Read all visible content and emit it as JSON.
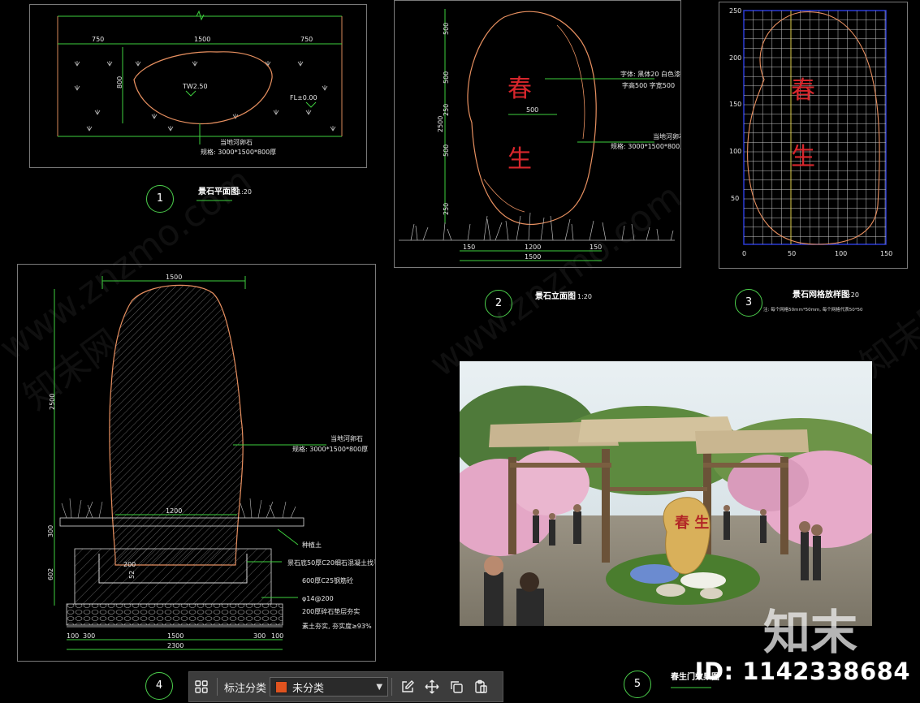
{
  "panels": {
    "p1": {
      "num": "1",
      "title": "景石平面图",
      "scale": "1:20",
      "dims": [
        "750",
        "1500",
        "750"
      ],
      "dim_v": "800",
      "label_tw": "TW2.50",
      "label_fl": "FL±0.00",
      "note1": "当地河卵石",
      "note2": "规格: 3000*1500*800厚"
    },
    "p2": {
      "num": "2",
      "title": "景石立面图",
      "scale": "1:20",
      "chars": [
        "春",
        "生"
      ],
      "dims_v": [
        "500",
        "500",
        "250",
        "500",
        "250"
      ],
      "dim_total": "2500",
      "dim_w": "500",
      "dims_b": [
        "150",
        "1200",
        "150"
      ],
      "dim_b_total": "1500",
      "note1": "字体: 黑体20  白色漆面",
      "note2": "字高500  字宽500",
      "note3": "当地河卵石",
      "note4": "规格: 3000*1500*800厚"
    },
    "p3": {
      "num": "3",
      "title": "景石网格放样图",
      "scale": "1:20",
      "subtitle": "注: 每个网格50mm*50mm, 每个网格代表50*50",
      "chars": [
        "春",
        "生"
      ],
      "y_ticks": [
        "250",
        "200",
        "150",
        "100",
        "50"
      ],
      "x_ticks": [
        "0",
        "50",
        "100",
        "150"
      ]
    },
    "p4": {
      "num": "4",
      "dim_top": "1500",
      "dim_h": "2500",
      "dim_300": "300",
      "dim_602": "602",
      "dim_52": "52",
      "dim_1200": "1200",
      "dims_b": [
        "100",
        "300",
        "1500",
        "300",
        "100"
      ],
      "dim_total": "2300",
      "dim_200": "200",
      "note_rock1": "当地河卵石",
      "note_rock2": "规格: 3000*1500*800厚",
      "note_soil": "种植土",
      "note_a": "景石底50厚C20细石混凝土找平",
      "note_b": "600厚C25钢筋砼",
      "note_c": "φ14@200",
      "note_d": "200厚碎石垫层夯实",
      "note_e": "素土夯实, 夯实度≥93%"
    },
    "p5": {
      "num": "5",
      "title": "春生门效果图",
      "sign": "春 生"
    }
  },
  "toolbar": {
    "label": "标注分类",
    "select_value": "未分类",
    "swatch_color": "#e0531f"
  },
  "watermark": {
    "id": "ID: 1142338684",
    "logo": "知末",
    "site": "www.znzmo.com",
    "cn": "知末网"
  }
}
